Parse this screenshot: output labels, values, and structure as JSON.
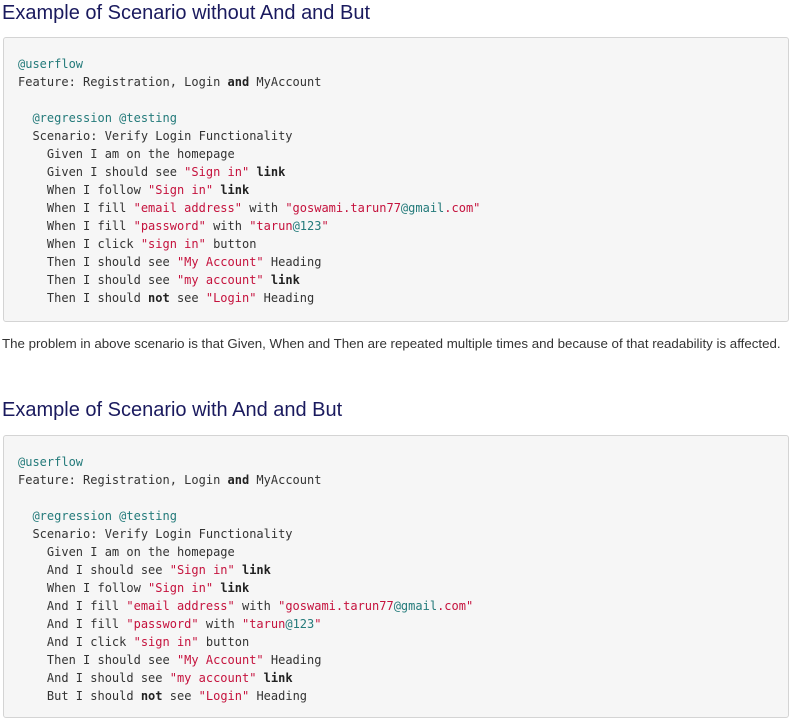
{
  "section1": {
    "heading": "Example of Scenario without And and But",
    "code_lines": [
      [
        {
          "t": "@userflow",
          "c": "tag"
        }
      ],
      [
        {
          "t": "Feature: Registration, Login ",
          "c": ""
        },
        {
          "t": "and",
          "c": "kw"
        },
        {
          "t": " MyAccount",
          "c": ""
        }
      ],
      [],
      [
        {
          "t": "  ",
          "c": ""
        },
        {
          "t": "@regression @testing",
          "c": "tag"
        }
      ],
      [
        {
          "t": "  Scenario: Verify Login Functionality",
          "c": ""
        }
      ],
      [
        {
          "t": "    Given I am on the homepage",
          "c": ""
        }
      ],
      [
        {
          "t": "    Given I should see ",
          "c": ""
        },
        {
          "t": "\"Sign in\"",
          "c": "str"
        },
        {
          "t": " ",
          "c": ""
        },
        {
          "t": "link",
          "c": "kw"
        }
      ],
      [
        {
          "t": "    When I follow ",
          "c": ""
        },
        {
          "t": "\"Sign in\"",
          "c": "str"
        },
        {
          "t": " ",
          "c": ""
        },
        {
          "t": "link",
          "c": "kw"
        }
      ],
      [
        {
          "t": "    When I fill ",
          "c": ""
        },
        {
          "t": "\"email address\"",
          "c": "str"
        },
        {
          "t": " with ",
          "c": ""
        },
        {
          "t": "\"goswami.tarun77",
          "c": "str"
        },
        {
          "t": "@gmail",
          "c": "mail"
        },
        {
          "t": ".com\"",
          "c": "str"
        }
      ],
      [
        {
          "t": "    When I fill ",
          "c": ""
        },
        {
          "t": "\"password\"",
          "c": "str"
        },
        {
          "t": " with ",
          "c": ""
        },
        {
          "t": "\"tarun",
          "c": "str"
        },
        {
          "t": "@123",
          "c": "mail"
        },
        {
          "t": "\"",
          "c": "str"
        }
      ],
      [
        {
          "t": "    When I click ",
          "c": ""
        },
        {
          "t": "\"sign in\"",
          "c": "str"
        },
        {
          "t": " button",
          "c": ""
        }
      ],
      [
        {
          "t": "    Then I should see ",
          "c": ""
        },
        {
          "t": "\"My Account\"",
          "c": "str"
        },
        {
          "t": " Heading",
          "c": ""
        }
      ],
      [
        {
          "t": "    Then I should see ",
          "c": ""
        },
        {
          "t": "\"my account\"",
          "c": "str"
        },
        {
          "t": " ",
          "c": ""
        },
        {
          "t": "link",
          "c": "kw"
        }
      ],
      [
        {
          "t": "    Then I should ",
          "c": ""
        },
        {
          "t": "not",
          "c": "kw"
        },
        {
          "t": " see ",
          "c": ""
        },
        {
          "t": "\"Login\"",
          "c": "str"
        },
        {
          "t": " Heading",
          "c": ""
        }
      ]
    ]
  },
  "paragraph": "The problem in above scenario is that Given, When and Then are repeated multiple times and because of that readability is affected.",
  "section2": {
    "heading": "Example of Scenario with And and But",
    "code_lines": [
      [
        {
          "t": "@userflow",
          "c": "tag"
        }
      ],
      [
        {
          "t": "Feature: Registration, Login ",
          "c": ""
        },
        {
          "t": "and",
          "c": "kw"
        },
        {
          "t": " MyAccount",
          "c": ""
        }
      ],
      [],
      [
        {
          "t": "  ",
          "c": ""
        },
        {
          "t": "@regression @testing",
          "c": "tag"
        }
      ],
      [
        {
          "t": "  Scenario: Verify Login Functionality",
          "c": ""
        }
      ],
      [
        {
          "t": "    Given I am on the homepage",
          "c": ""
        }
      ],
      [
        {
          "t": "    And I should see ",
          "c": ""
        },
        {
          "t": "\"Sign in\"",
          "c": "str"
        },
        {
          "t": " ",
          "c": ""
        },
        {
          "t": "link",
          "c": "kw"
        }
      ],
      [
        {
          "t": "    When I follow ",
          "c": ""
        },
        {
          "t": "\"Sign in\"",
          "c": "str"
        },
        {
          "t": " ",
          "c": ""
        },
        {
          "t": "link",
          "c": "kw"
        }
      ],
      [
        {
          "t": "    And I fill ",
          "c": ""
        },
        {
          "t": "\"email address\"",
          "c": "str"
        },
        {
          "t": " with ",
          "c": ""
        },
        {
          "t": "\"goswami.tarun77",
          "c": "str"
        },
        {
          "t": "@gmail",
          "c": "mail"
        },
        {
          "t": ".com\"",
          "c": "str"
        }
      ],
      [
        {
          "t": "    And I fill ",
          "c": ""
        },
        {
          "t": "\"password\"",
          "c": "str"
        },
        {
          "t": " with ",
          "c": ""
        },
        {
          "t": "\"tarun",
          "c": "str"
        },
        {
          "t": "@123",
          "c": "mail"
        },
        {
          "t": "\"",
          "c": "str"
        }
      ],
      [
        {
          "t": "    And I click ",
          "c": ""
        },
        {
          "t": "\"sign in\"",
          "c": "str"
        },
        {
          "t": " button",
          "c": ""
        }
      ],
      [
        {
          "t": "    Then I should see ",
          "c": ""
        },
        {
          "t": "\"My Account\"",
          "c": "str"
        },
        {
          "t": " Heading",
          "c": ""
        }
      ],
      [
        {
          "t": "    And I should see ",
          "c": ""
        },
        {
          "t": "\"my account\"",
          "c": "str"
        },
        {
          "t": " ",
          "c": ""
        },
        {
          "t": "link",
          "c": "kw"
        }
      ],
      [
        {
          "t": "    But I should ",
          "c": ""
        },
        {
          "t": "not",
          "c": "kw"
        },
        {
          "t": " see ",
          "c": ""
        },
        {
          "t": "\"Login\"",
          "c": "str"
        },
        {
          "t": " Heading",
          "c": ""
        }
      ]
    ]
  },
  "colors": {
    "heading": "#1a1a5e",
    "tag": "#237a7a",
    "string": "#c5123d",
    "code_background": "#f6f6f6",
    "code_border": "#d4d4d4"
  }
}
